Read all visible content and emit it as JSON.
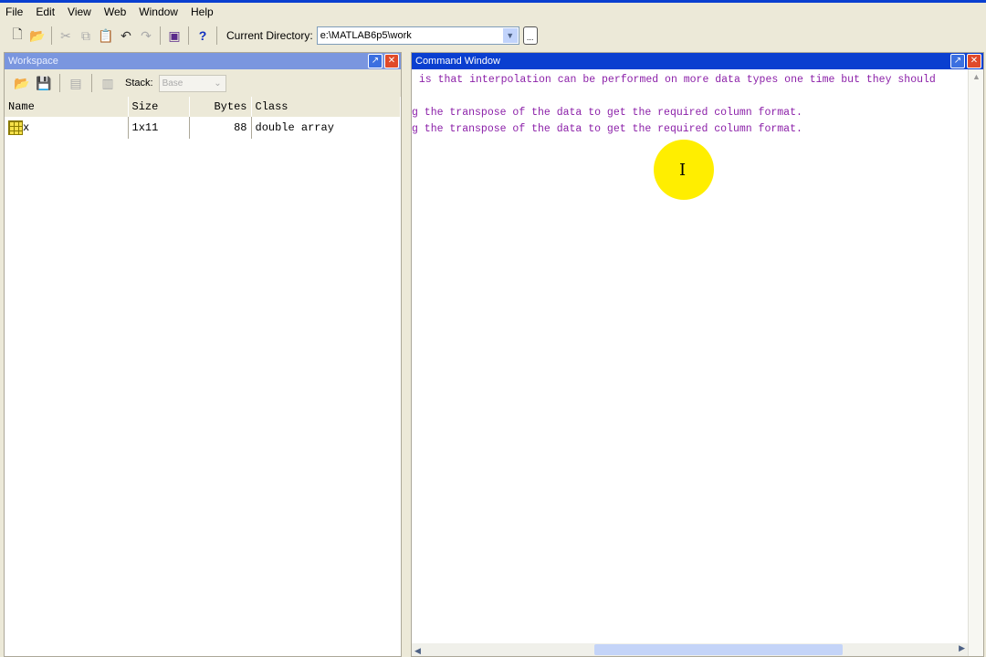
{
  "menu": [
    "File",
    "Edit",
    "View",
    "Web",
    "Window",
    "Help"
  ],
  "toolbar": {
    "current_directory_label": "Current Directory:",
    "current_directory": "e:\\MATLAB6p5\\work",
    "browse": "..."
  },
  "workspace": {
    "title": "Workspace",
    "stack_label": "Stack:",
    "stack_value": "Base",
    "columns": [
      "Name",
      "Size",
      "Bytes",
      "Class"
    ],
    "rows": [
      {
        "name": "x",
        "size": "1x11",
        "bytes": "88",
        "class": "double array"
      }
    ]
  },
  "command_window": {
    "title": "Command Window",
    "lines": [
      " is that interpolation can be performed on more data types one time but they should",
      "",
      "g the transpose of the data to get the required column format.",
      "g the transpose of the data to get the required column format."
    ]
  },
  "colors": {
    "command_text": "#8b1fa8",
    "title_active": "#0a3fd0",
    "cursor_highlight": "#ffee00"
  }
}
